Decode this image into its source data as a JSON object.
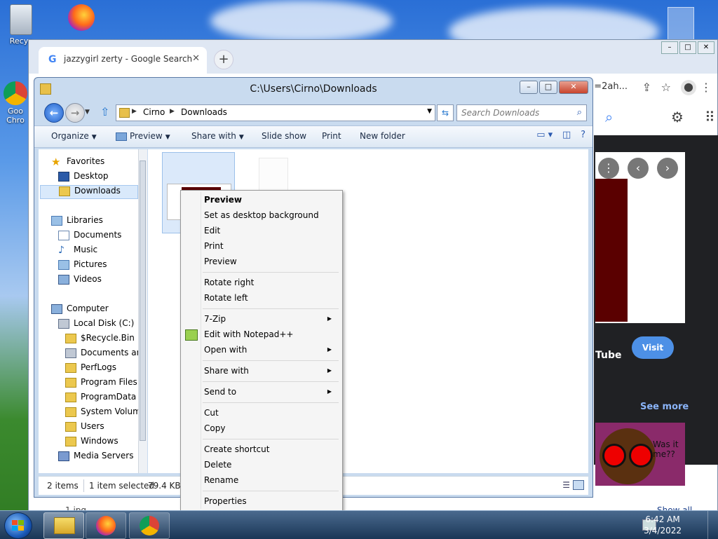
{
  "desktop": {
    "recycle_label": "Recyc",
    "chrome_label_1": "Goo",
    "chrome_label_2": "Chro"
  },
  "chrome": {
    "tab_title": "jazzygirl zerty - Google Search",
    "url_tail": "=2ah...",
    "visit_label": "Visit",
    "tube_label": "Tube",
    "see_more": "See more",
    "thumb_text_1": "Was it",
    "thumb_text_2": "me??",
    "show_all": "Show all",
    "file_hint": "1.jpg"
  },
  "explorer": {
    "title": "C:\\Users\\Cirno\\Downloads",
    "breadcrumb": [
      "Cirno",
      "Downloads"
    ],
    "search_placeholder": "Search Downloads",
    "commands": {
      "organize": "Organize",
      "preview": "Preview",
      "share_with": "Share with",
      "slide_show": "Slide show",
      "print": "Print",
      "new_folder": "New folder"
    },
    "nav": {
      "favorites": "Favorites",
      "desktop": "Desktop",
      "downloads": "Downloads",
      "libraries": "Libraries",
      "documents": "Documents",
      "music": "Music",
      "pictures": "Pictures",
      "videos": "Videos",
      "computer": "Computer",
      "local_disk": "Local Disk (C:)",
      "recycle_bin": "$Recycle.Bin",
      "documents_and": "Documents and",
      "perflogs": "PerfLogs",
      "program_files": "Program Files",
      "programdata": "ProgramData",
      "system_volume": "System Volume",
      "users": "Users",
      "windows": "Windows",
      "media_servers": "Media Servers"
    },
    "status": {
      "items": "2 items",
      "selected": "1 item selected",
      "size": "79.4 KB"
    }
  },
  "context_menu": {
    "preview_bold": "Preview",
    "set_desktop_bg": "Set as desktop background",
    "edit": "Edit",
    "print": "Print",
    "preview": "Preview",
    "rotate_right": "Rotate right",
    "rotate_left": "Rotate left",
    "seven_zip": "7-Zip",
    "edit_notepad": "Edit with Notepad++",
    "open_with": "Open with",
    "share_with": "Share with",
    "send_to": "Send to",
    "cut": "Cut",
    "copy": "Copy",
    "create_shortcut": "Create shortcut",
    "delete": "Delete",
    "rename": "Rename",
    "properties": "Properties"
  },
  "taskbar": {
    "time": "6:42 AM",
    "date": "3/4/2022"
  },
  "colors": {
    "accent": "#1f5fc8",
    "selection": "#d9e9fb",
    "visit_button": "#4d90e6"
  }
}
